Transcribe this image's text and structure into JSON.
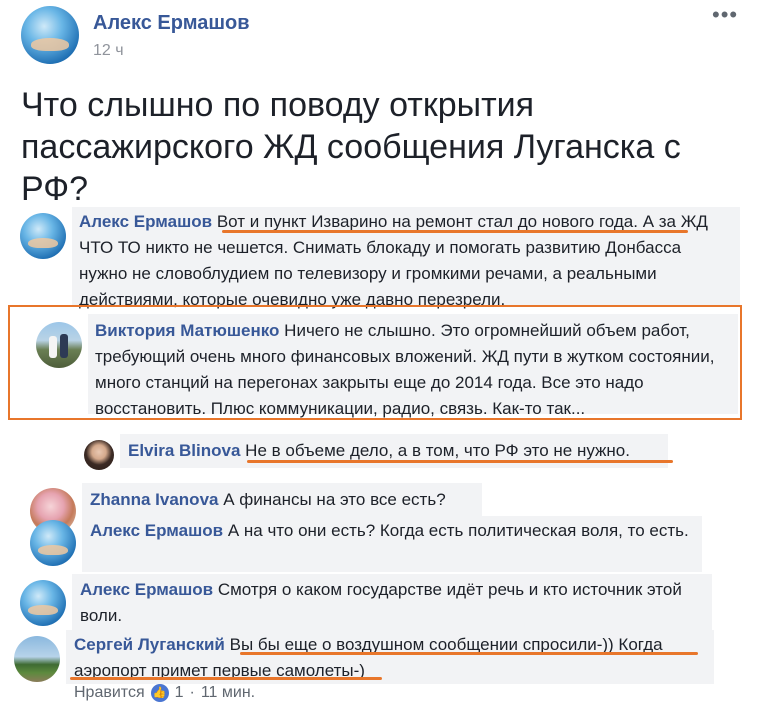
{
  "post": {
    "author": "Алекс Ермашов",
    "time": "12 ч",
    "title": "Что слышно по поводу открытия пассажирского ЖД сообщения Луганска с РФ?"
  },
  "comments": [
    {
      "author": "Алекс Ермашов",
      "text": "Вот и пункт Изварино на ремонт стал до нового года. А за ЖД ЧТО ТО никто не чешется. Снимать блокаду и помогать развитию Донбасса нужно не словоблудием по телевизору и громкими речами, а реальными действиями, которые очевидно уже давно перезрели."
    },
    {
      "author": "Виктория Матюшенко",
      "text": "Ничего не слышно. Это огромнейший объем работ, требующий очень много финансовых вложений. ЖД пути в жутком состоянии, много станций на перегонах закрыты еще до 2014 года. Все это надо восстановить. Плюс коммуникации, радио, связь. Как-то так..."
    },
    {
      "author": "Elvira Blinova",
      "text": "Не в объеме дело, а в том, что РФ это не нужно."
    },
    {
      "author": "Zhanna Ivanova",
      "text": "А финансы на это все есть?"
    },
    {
      "author": "Алекс Ермашов",
      "text": "А на что они есть? Когда есть политическая воля, то есть."
    },
    {
      "author": "Алекс Ермашов",
      "text": "Смотря о каком государстве идёт речь и кто источник этой воли."
    },
    {
      "author": "Сергей Луганский",
      "text": "Вы бы еще о воздушном сообщении спросили-)) Когда аэропорт примет первые самолеты-)"
    }
  ],
  "footer": {
    "like": "Нравится",
    "count": "1",
    "sep": "·",
    "time": "11 мин."
  },
  "colors": {
    "accent": "#e8762b",
    "link": "#385898"
  }
}
